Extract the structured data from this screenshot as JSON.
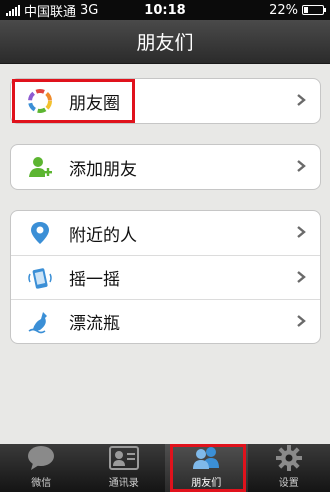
{
  "status_bar": {
    "carrier": "中国联通",
    "network": "3G",
    "time": "10:18",
    "battery": "22%",
    "battery_level": 0.22
  },
  "navbar": {
    "title": "朋友们"
  },
  "groups": [
    {
      "items": [
        {
          "label": "朋友圈",
          "icon": "moments-icon"
        }
      ]
    },
    {
      "items": [
        {
          "label": "添加朋友",
          "icon": "add-friend-icon"
        }
      ]
    },
    {
      "items": [
        {
          "label": "附近的人",
          "icon": "location-pin-icon"
        },
        {
          "label": "摇一摇",
          "icon": "shake-phone-icon"
        },
        {
          "label": "漂流瓶",
          "icon": "drift-bottle-icon"
        }
      ]
    }
  ],
  "tabbar": {
    "items": [
      {
        "label": "微信",
        "icon": "chat-bubble-icon"
      },
      {
        "label": "通讯录",
        "icon": "contacts-card-icon"
      },
      {
        "label": "朋友们",
        "icon": "friends-icon",
        "active": true
      },
      {
        "label": "设置",
        "icon": "gear-icon"
      }
    ]
  },
  "colors": {
    "highlight": "#e0121c",
    "accent_green": "#5cb531",
    "accent_blue": "#3b8fd6"
  }
}
